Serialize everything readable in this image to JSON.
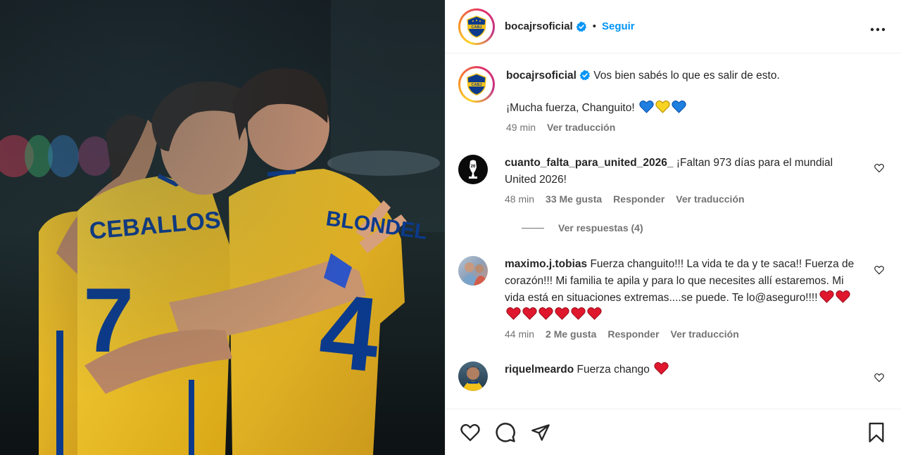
{
  "header": {
    "username": "bocajrsoficial",
    "separator": "•",
    "follow_label": "Seguir",
    "more_label": "•••"
  },
  "caption": {
    "username": "bocajrsoficial",
    "text": "Vos bien sabés lo que es salir de esto.",
    "text2": "¡Mucha fuerza, Changuito!",
    "emojis": [
      "blue-heart",
      "yellow-heart",
      "blue-heart"
    ],
    "time": "49 min",
    "translate": "Ver traducción"
  },
  "comments": [
    {
      "username": "cuanto_falta_para_united_2026_",
      "text": "¡Faltan 973 días para el mundial United 2026!",
      "time": "48 min",
      "likes": "33 Me gusta",
      "reply": "Responder",
      "translate": "Ver traducción",
      "view_replies": "Ver respuestas (4)"
    },
    {
      "username": "maximo.j.tobias",
      "text": "Fuerza changuito!!! La vida te da y te saca!! Fuerza de corazón!!! Mi familia te apila y para lo que necesites allí estaremos. Mi vida está en situaciones extremas....se puede. Te lo@aseguro!!!!",
      "hearts": 8,
      "time": "44 min",
      "likes": "2 Me gusta",
      "reply": "Responder",
      "translate": "Ver traducción"
    },
    {
      "username": "riquelmeardo",
      "text": "Fuerza chango",
      "hearts": 1
    }
  ],
  "photo": {
    "jersey_left_name": "CEBALLOS",
    "jersey_left_number": "7",
    "jersey_right_name": "BLONDEL",
    "jersey_right_number": "4"
  },
  "colors": {
    "accent": "#0095f6",
    "boca_blue": "#0b3a8c",
    "boca_yellow": "#f2c21b",
    "secondary_text": "#737373",
    "heart_red": "#e0182d"
  },
  "icons": [
    "like-icon",
    "comment-icon",
    "share-icon",
    "save-icon",
    "verified-icon",
    "more-icon"
  ]
}
